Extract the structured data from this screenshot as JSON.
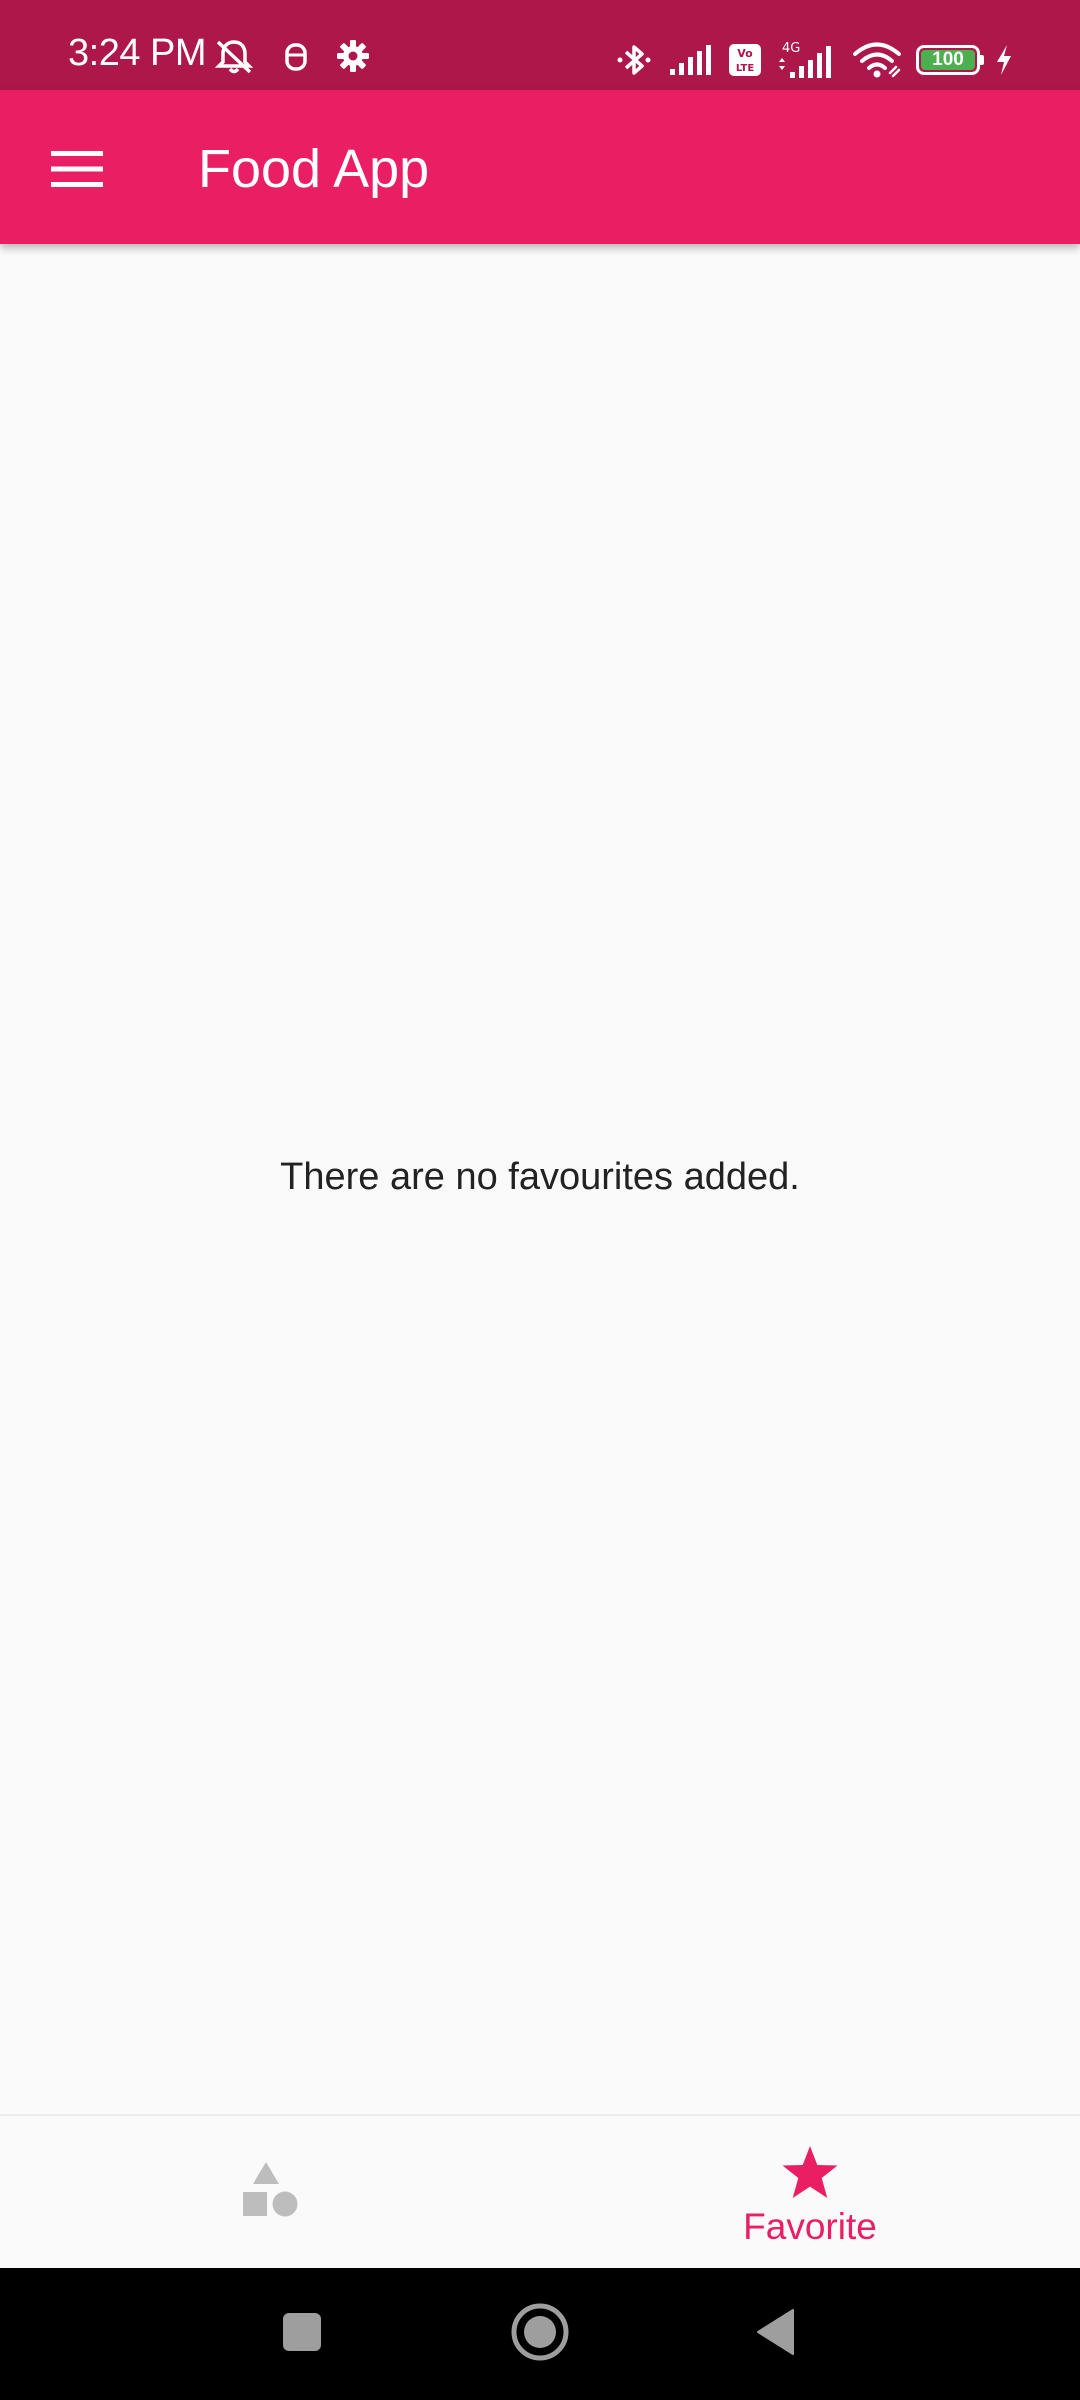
{
  "status_bar": {
    "time": "3:24 PM",
    "battery_level": "100",
    "network_label": "4G",
    "volte_label": "Vo LTE",
    "background": "#ad1749"
  },
  "app_bar": {
    "title": "Food App",
    "menu_icon": "hamburger-menu-icon",
    "background": "#e91e63"
  },
  "main": {
    "empty_message": "There are no favourites added."
  },
  "bottom_nav": {
    "items": [
      {
        "icon": "categories-shapes-icon",
        "label": "",
        "selected": false
      },
      {
        "icon": "star-icon",
        "label": "Favorite",
        "selected": true
      }
    ],
    "active_color": "#e91e63",
    "inactive_color": "#bdbdbd"
  },
  "system_nav": {
    "buttons": [
      "recents-square-icon",
      "home-circle-icon",
      "back-triangle-icon"
    ]
  }
}
